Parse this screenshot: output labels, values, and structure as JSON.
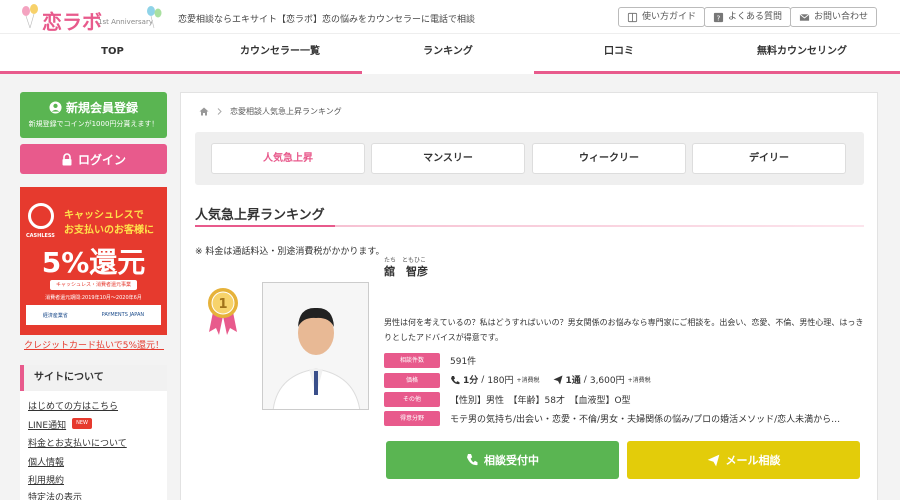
{
  "header": {
    "logo_text": "恋ラボ",
    "logo_sub": "1st Anniversary",
    "tagline": "恋愛相談ならエキサイト【恋ラボ】恋の悩みをカウンセラーに電話で相談",
    "guide": "使い方ガイド",
    "faq": "よくある質問",
    "contact": "お問い合わせ"
  },
  "nav": [
    "TOP",
    "カウンセラー一覧",
    "ランキング",
    "口コミ",
    "無料カウンセリング"
  ],
  "sidebar": {
    "register_label": "新規会員登録",
    "register_sub": "新規登録でコインが1000円分貰えます！",
    "login_label": "ログイン",
    "banner": {
      "cashless": "CASHLESS",
      "line1": "キャッシュレスで",
      "line2": "お支払いのお客様に",
      "big": "5%還元",
      "pill": "キャッシュレス・消費者還元事業",
      "period": "消費者還元期間:2019年10月〜2020年6月",
      "logo1": "経済産業省",
      "logo2": "PAYMENTS JAPAN"
    },
    "cc_link": "クレジットカード払いで5%還元！",
    "site_title": "サイトについて",
    "site_links": [
      "はじめての方はこちら",
      "LINE通知",
      "料金とお支払いについて",
      "個人情報",
      "利用規約",
      "特定法の表示"
    ],
    "new_badge": "NEW"
  },
  "main": {
    "breadcrumb": "恋愛相談人気急上昇ランキング",
    "tabs": [
      "人気急上昇",
      "マンスリー",
      "ウィークリー",
      "デイリー"
    ],
    "section_title": "人気急上昇ランキング",
    "note": "※ 料金は通話料込・別途消費税がかかります。",
    "counselor": {
      "rank": "1",
      "ruby": "たち　ともひこ",
      "name": "舘　智彦",
      "desc": "男性は何を考えているの？私はどうすればいいの？男女関係のお悩みなら専門家にご相談を。出会い、恋愛、不倫、男性心理、はっきりとしたアドバイスが得意です。",
      "labels": [
        "相談件数",
        "価格",
        "その他",
        "得意分野"
      ],
      "count": "591件",
      "phone_unit": "1分",
      "phone_price": "180円",
      "tax": "+消費税",
      "mail_unit": "1通",
      "mail_price": "3,600円",
      "other": "【性別】男性　【年齢】58才　【血液型】O型",
      "specialty": "モテ男の気持ち/出会い・恋愛・不倫/男女・夫婦関係の悩み/プロの婚活メソッド/恋人未満から…",
      "consult_label": "相談受付中",
      "mail_label": "メール相談"
    }
  }
}
